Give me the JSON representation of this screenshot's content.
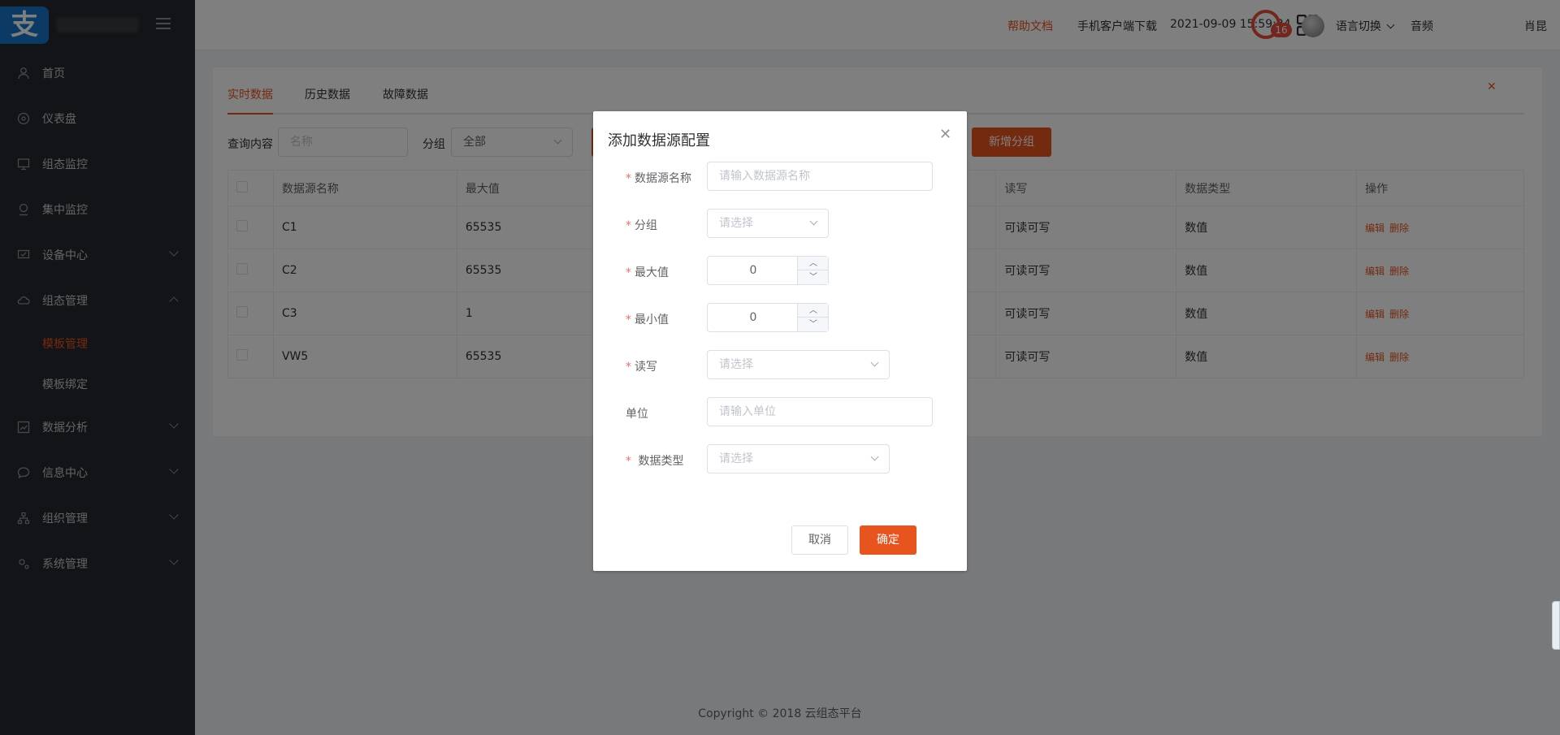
{
  "sidebar": {
    "logo_char": "支",
    "items": [
      {
        "label": "首页",
        "icon": "user-icon"
      },
      {
        "label": "仪表盘",
        "icon": "dashboard-icon"
      },
      {
        "label": "组态监控",
        "icon": "monitor-icon"
      },
      {
        "label": "集中监控",
        "icon": "location-icon"
      },
      {
        "label": "设备中心",
        "icon": "device-icon"
      },
      {
        "label": "组态管理",
        "icon": "cloud-icon"
      },
      {
        "label": "数据分析",
        "icon": "chart-icon"
      },
      {
        "label": "信息中心",
        "icon": "message-icon"
      },
      {
        "label": "组织管理",
        "icon": "org-icon"
      },
      {
        "label": "系统管理",
        "icon": "settings-icon"
      }
    ],
    "sub_items": [
      "模板管理",
      "模板绑定"
    ]
  },
  "header": {
    "help": "帮助文档",
    "download": "手机客户端下载",
    "datetime": "2021-09-09 15:59:34",
    "language": "语言切换",
    "audio": "音频",
    "notify_count": "16",
    "username": "肖昆"
  },
  "tabs": [
    "实时数据",
    "历史数据",
    "故障数据"
  ],
  "filters": {
    "query_label": "查询内容",
    "query_placeholder": "名称",
    "group_label": "分组",
    "group_value": "全部",
    "add_group": "新增分组"
  },
  "table": {
    "headers": [
      "数据源名称",
      "最大值",
      "读写",
      "数据类型",
      "操作"
    ],
    "rows": [
      {
        "name": "C1",
        "max": "65535",
        "rw": "可读可写",
        "type": "数值"
      },
      {
        "name": "C2",
        "max": "65535",
        "rw": "可读可写",
        "type": "数值"
      },
      {
        "name": "C3",
        "max": "1",
        "rw": "可读可写",
        "type": "数值"
      },
      {
        "name": "VW5",
        "max": "65535",
        "rw": "可读可写",
        "type": "数值"
      }
    ],
    "edit": "编辑",
    "delete": "删除"
  },
  "copyright": "Copyright © 2018 云组态平台",
  "dialog": {
    "title": "添加数据源配置",
    "fields": {
      "name_label": "数据源名称",
      "name_placeholder": "请输入数据源名称",
      "group_label": "分组",
      "group_placeholder": "请选择",
      "max_label": "最大值",
      "max_value": "0",
      "min_label": "最小值",
      "min_value": "0",
      "rw_label": "读写",
      "rw_placeholder": "请选择",
      "unit_label": "单位",
      "unit_placeholder": "请输入单位",
      "type_label": "数据类型",
      "type_placeholder": "请选择"
    },
    "cancel": "取消",
    "ok": "确定"
  },
  "colors": {
    "accent": "#e8541e",
    "sidebar": "#27292e",
    "required": "#f56c6c"
  }
}
